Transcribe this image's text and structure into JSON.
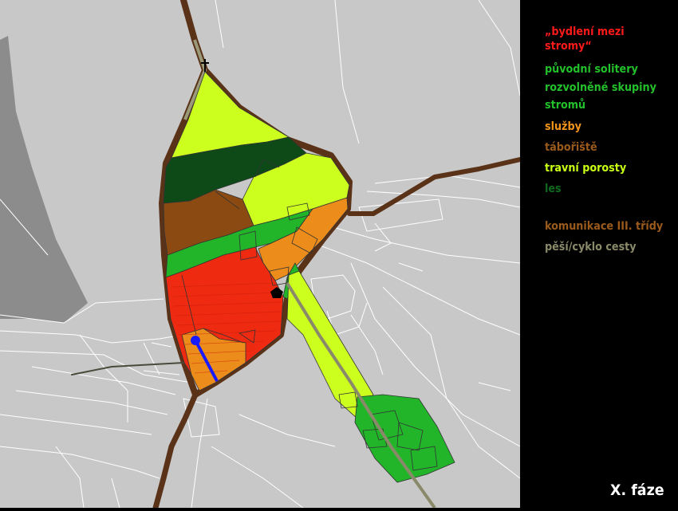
{
  "legend": {
    "items": [
      {
        "label": "„bydlení mezi",
        "color": "#ff1a1a"
      },
      {
        "label": "stromy“",
        "color": "#ff1a1a"
      },
      {
        "label": "původní solitery",
        "color": "#22c02a"
      },
      {
        "label": "rozvolněné skupiny",
        "color": "#22c02a"
      },
      {
        "label": "stromů",
        "color": "#22c02a"
      },
      {
        "label": "služby",
        "color": "#f0941c"
      },
      {
        "label": "tábořiště",
        "color": "#9a5a1c"
      },
      {
        "label": "travní porosty",
        "color": "#c8ff14"
      },
      {
        "label": "les",
        "color": "#0e6a20"
      },
      {
        "label": "komunikace III. třídy",
        "color": "#9a5a1c"
      },
      {
        "label": "pěší/cyklo cesty",
        "color": "#8a8a6a"
      }
    ]
  },
  "phase_label": "X. fáze",
  "colors": {
    "background": "#000000",
    "map_base": "#c8c8c8",
    "built_up_gray": "#8c8c8c",
    "parcel_lines": "#ffffff",
    "road": "#5a3218",
    "path": "#8a8a6a",
    "blue_path": "#1a1aff"
  }
}
